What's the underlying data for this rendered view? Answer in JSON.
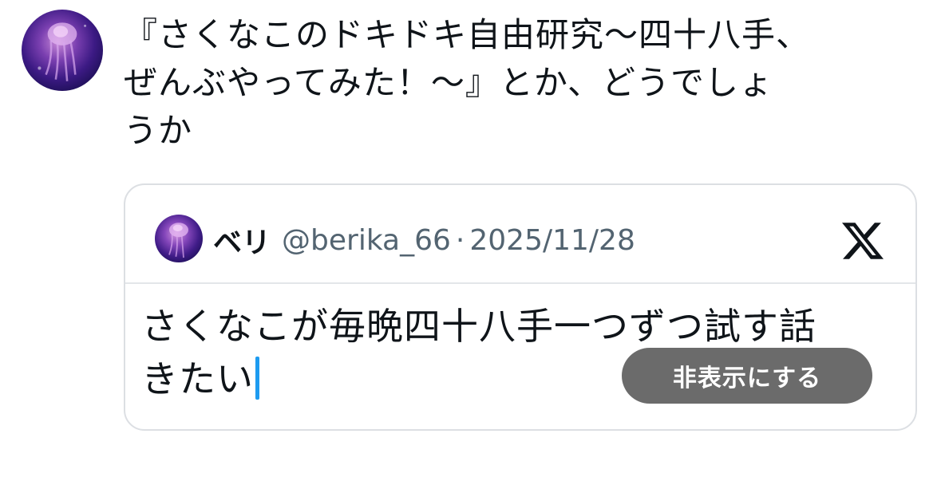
{
  "post": {
    "avatar_icon": "jellyfish-avatar",
    "text": "『さくなこのドキドキ自由研究〜四十八手、\nぜんぶやってみた！〜』とか、どうでしょ\nうか"
  },
  "quote": {
    "avatar_icon": "jellyfish-avatar",
    "display_name": "ベリ",
    "handle": "@berika_66",
    "separator": "·",
    "date": "2025/11/28",
    "close_icon": "x-logo-icon",
    "body_line1": "さくなこが毎晩四十八手一つずつ試す話",
    "body_line2": "きたい",
    "hide_button_label": "非表示にする"
  },
  "colors": {
    "text_primary": "#0f1419",
    "text_secondary": "#536471",
    "card_border": "#dcdfe3",
    "hide_button_bg": "#6b6b6b",
    "caret": "#1d9bf0"
  }
}
